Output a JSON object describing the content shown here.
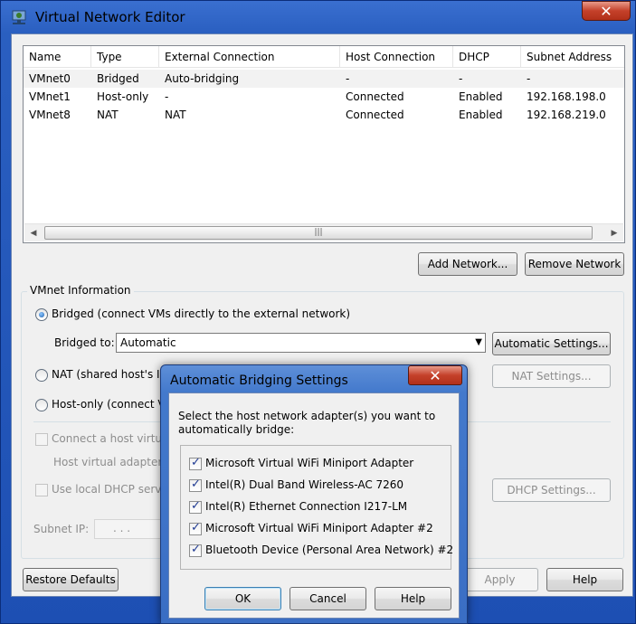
{
  "window": {
    "title": "Virtual Network Editor",
    "close_glyph": "✕"
  },
  "table": {
    "columns": [
      "Name",
      "Type",
      "External Connection",
      "Host Connection",
      "DHCP",
      "Subnet Address"
    ],
    "rows": [
      {
        "name": "VMnet0",
        "type": "Bridged",
        "external": "Auto-bridging",
        "host": "-",
        "dhcp": "-",
        "subnet": "-"
      },
      {
        "name": "VMnet1",
        "type": "Host-only",
        "external": "-",
        "host": "Connected",
        "dhcp": "Enabled",
        "subnet": "192.168.198.0"
      },
      {
        "name": "VMnet8",
        "type": "NAT",
        "external": "NAT",
        "host": "Connected",
        "dhcp": "Enabled",
        "subnet": "192.168.219.0"
      }
    ],
    "scroll_left": "◀",
    "scroll_right": "▶",
    "scroll_grip": "|||"
  },
  "buttons": {
    "add_network": "Add Network...",
    "remove_network": "Remove Network",
    "automatic_settings": "Automatic Settings...",
    "nat_settings": "NAT Settings...",
    "dhcp_settings": "DHCP Settings...",
    "restore_defaults": "Restore Defaults",
    "apply": "Apply",
    "help": "Help"
  },
  "vmnet_info": {
    "group_title": "VMnet Information",
    "bridged_label": "Bridged (connect VMs directly to the external network)",
    "bridged_to_label": "Bridged to:",
    "bridged_to_value": "Automatic",
    "nat_label": "NAT (shared host's IP",
    "host_only_label": "Host-only (connect VM",
    "connect_host_adapter_label": "Connect a host virtua",
    "host_adapter_name_label": "Host virtual adapter n",
    "use_dhcp_label": "Use local DHCP servic",
    "subnet_ip_label": "Subnet IP:",
    "subnet_ip_value": ".       .       .",
    "selected_mode": "bridged"
  },
  "dialog": {
    "title": "Automatic Bridging Settings",
    "close_glyph": "✕",
    "prompt": "Select the host network adapter(s) you want to automatically bridge:",
    "adapters": [
      {
        "label": "Microsoft Virtual WiFi Miniport Adapter",
        "checked": true
      },
      {
        "label": "Intel(R) Dual Band Wireless-AC 7260",
        "checked": true
      },
      {
        "label": "Intel(R) Ethernet Connection I217-LM",
        "checked": true
      },
      {
        "label": "Microsoft Virtual WiFi Miniport Adapter #2",
        "checked": true
      },
      {
        "label": "Bluetooth Device (Personal Area Network) #2",
        "checked": true
      }
    ],
    "ok": "OK",
    "cancel": "Cancel",
    "help": "Help"
  },
  "colors": {
    "title_bar": "#2a5fc0",
    "client_background": "#f0f0f0",
    "close_button": "#c4412a"
  }
}
